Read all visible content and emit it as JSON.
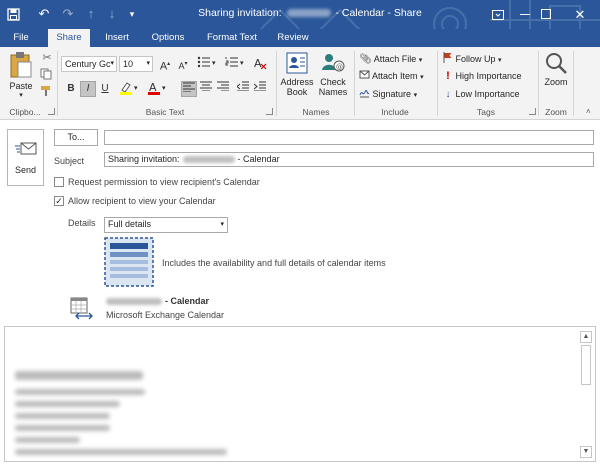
{
  "window": {
    "title_prefix": "Sharing invitation:",
    "title_suffix": "- Calendar - Share"
  },
  "tabs": [
    "File",
    "Share",
    "Insert",
    "Options",
    "Format Text",
    "Review"
  ],
  "ribbon": {
    "clipboard": {
      "paste": "Paste",
      "group": "Clipbo..."
    },
    "basic_text": {
      "font": "Century Gc",
      "size": "10",
      "group": "Basic Text",
      "bold": "B",
      "italic": "I",
      "underline": "U"
    },
    "names": {
      "address_book_line1": "Address",
      "address_book_line2": "Book",
      "check_names_line1": "Check",
      "check_names_line2": "Names",
      "group": "Names"
    },
    "include": {
      "attach_file": "Attach File",
      "attach_item": "Attach Item",
      "signature": "Signature",
      "group": "Include"
    },
    "tags": {
      "follow_up": "Follow Up",
      "high_importance": "High Importance",
      "low_importance": "Low Importance",
      "group": "Tags"
    },
    "zoom": {
      "label": "Zoom",
      "group": "Zoom"
    }
  },
  "form": {
    "send": "Send",
    "to_button": "To...",
    "to_value": "",
    "subject_label": "Subject",
    "subject_prefix": "Sharing invitation:",
    "subject_suffix": "- Calendar",
    "request_permission": "Request permission to view recipient's Calendar",
    "request_permission_checked": false,
    "allow_recipient": "Allow recipient to view your Calendar",
    "allow_recipient_checked": true,
    "details_label": "Details",
    "details_value": "Full details",
    "details_description": "Includes the availability and full details of calendar items",
    "calendar_suffix": "- Calendar",
    "calendar_type": "Microsoft Exchange Calendar"
  },
  "colors": {
    "titlebar": "#2b579a",
    "ribbon": "#f3f3f3",
    "accent_flag": "#c43e1c",
    "importance_high": "#c00000",
    "importance_low": "#2b579a"
  }
}
